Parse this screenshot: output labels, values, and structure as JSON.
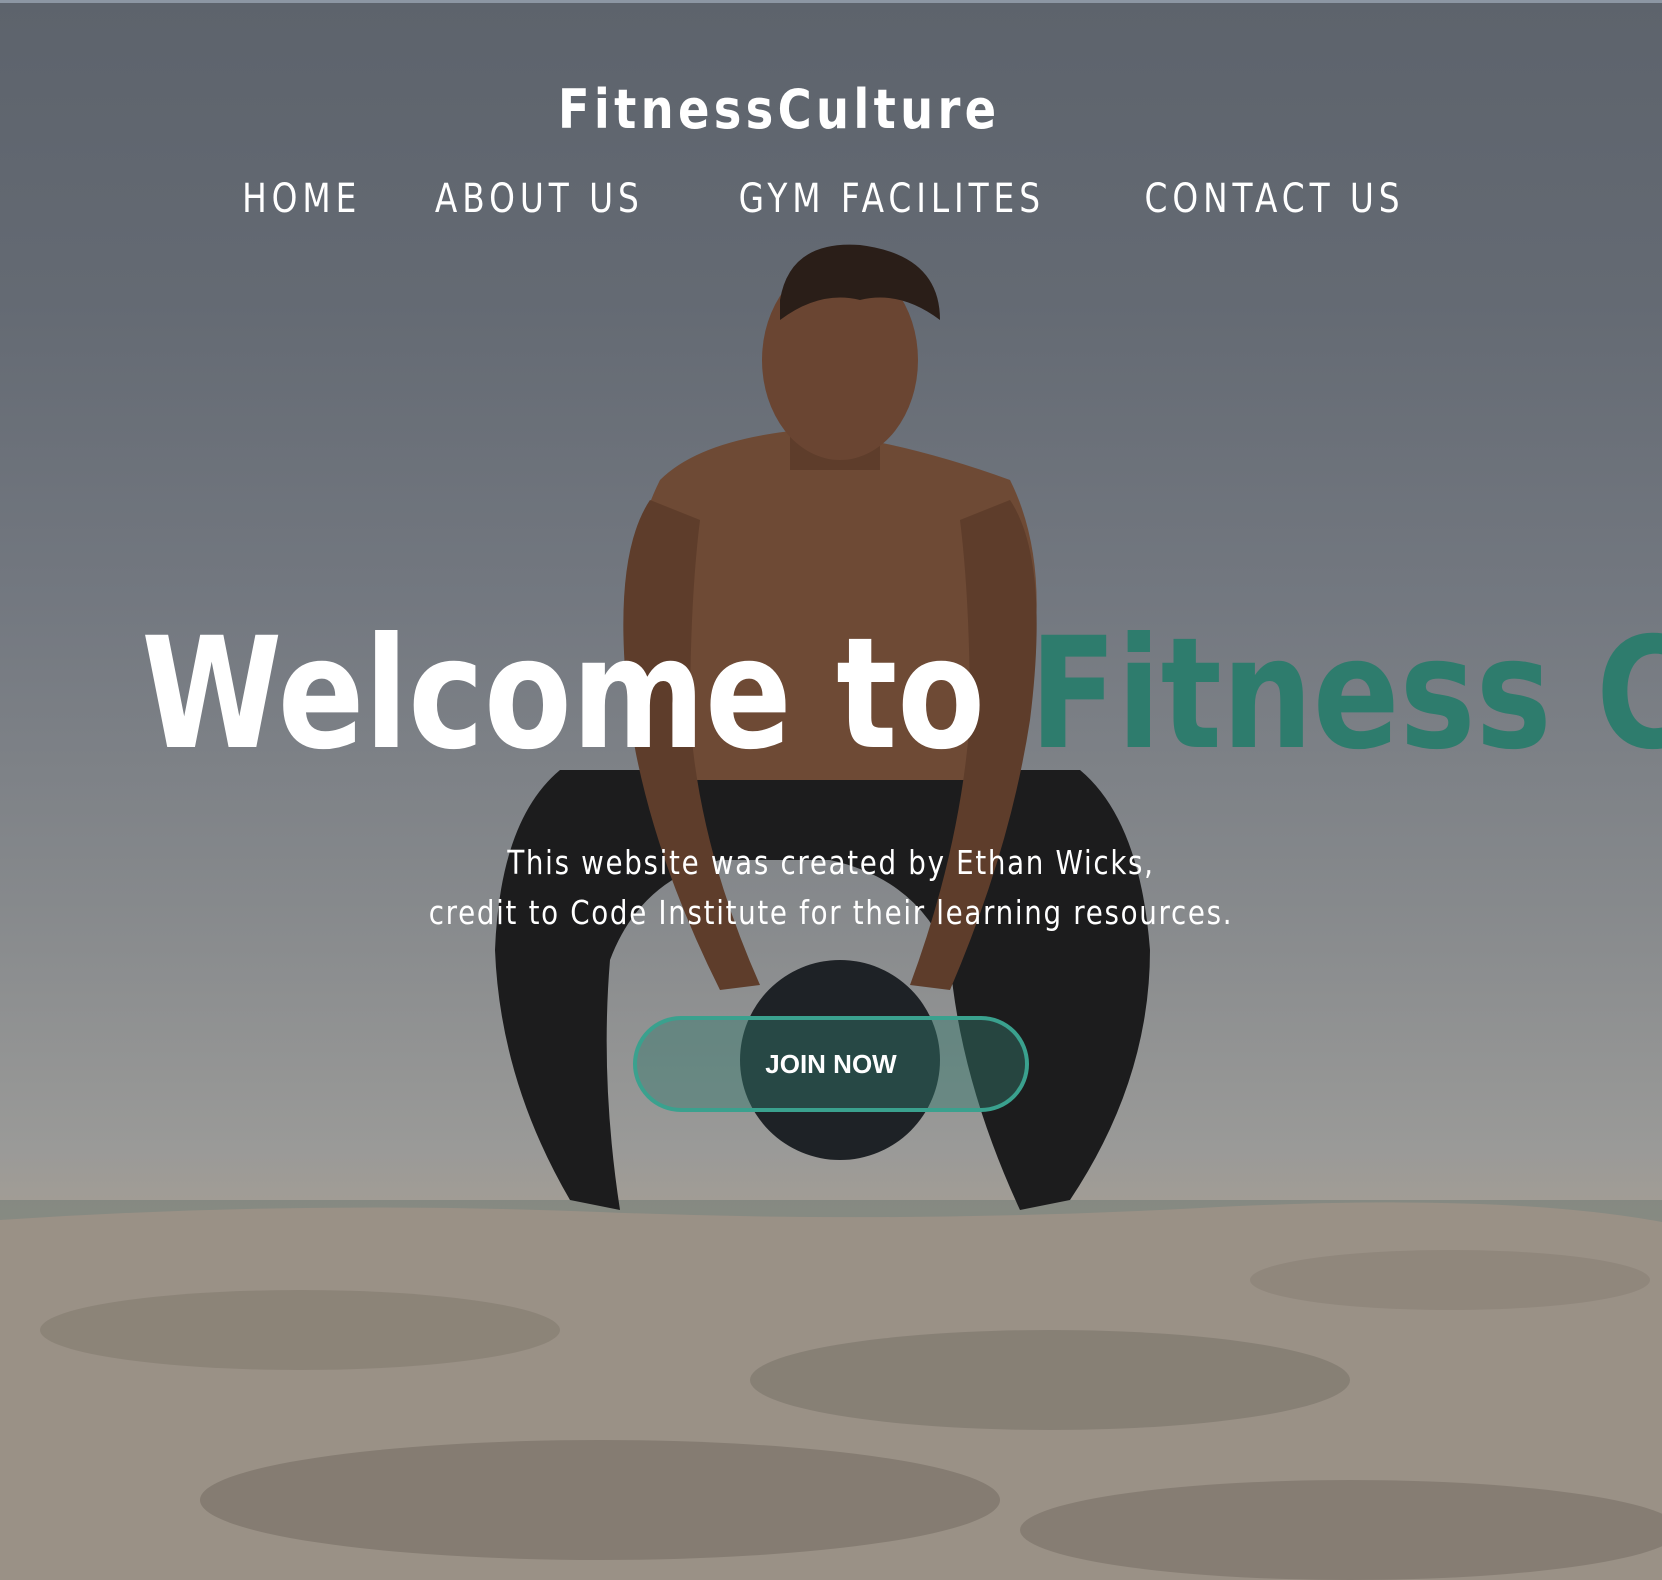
{
  "brand": {
    "name": "FitnessCulture"
  },
  "nav": {
    "items": [
      {
        "label": "HOME"
      },
      {
        "label": "ABOUT US"
      },
      {
        "label": "GYM FACILITES"
      },
      {
        "label": "CONTACT US"
      }
    ]
  },
  "hero": {
    "headline_white": "Welcome to ",
    "headline_accent": "Fitness Culture",
    "credit_line1": "This website was created by Ethan Wicks,",
    "credit_line2": "credit to Code Institute for their learning resources.",
    "cta_label": "JOIN NOW"
  },
  "colors": {
    "accent": "#2e7c6d",
    "button_border": "#3aa18e",
    "text": "#ffffff"
  }
}
